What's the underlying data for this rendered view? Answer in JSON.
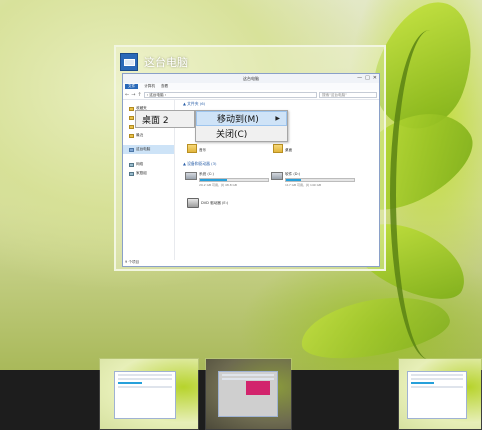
{
  "switcher": {
    "window_title": "这台电脑"
  },
  "explorer": {
    "titlebar_text": "这台电脑",
    "ribbon_tabs": [
      "文件",
      "计算机",
      "查看"
    ],
    "address": "› 这台电脑 ›",
    "search_placeholder": "搜索\"这台电脑\"",
    "nav_items": [
      {
        "label": "收藏夹",
        "icon": "star-icon"
      },
      {
        "label": "桌面",
        "icon": "folder-icon"
      },
      {
        "label": "下载",
        "icon": "folder-icon"
      },
      {
        "label": "最近",
        "icon": "folder-icon"
      },
      {
        "label": "这台电脑",
        "icon": "computer-icon"
      },
      {
        "label": "网络",
        "icon": "network-icon"
      },
      {
        "label": "家庭组",
        "icon": "homegroup-icon"
      }
    ],
    "folders_section": "▲ 文件夹 (6)",
    "folder_labels": [
      "音乐",
      "桌面"
    ],
    "devices_section": "▲ 设备和驱动器 (3)",
    "drives": [
      {
        "name": "系统 (C:)",
        "free": "29.2 GB 可用，共 48.8 GB",
        "used_fraction": 0.4
      },
      {
        "name": "软件 (D:)",
        "free": "117 GB 可用，共 149 GB",
        "used_fraction": 0.22
      }
    ],
    "dvd_label": "DVD 驱动器 (E:)",
    "status": "9 个项目",
    "window_buttons": [
      "—",
      "□",
      "✕"
    ]
  },
  "context_menu": {
    "parent_item": "桌面 2",
    "items": [
      {
        "label": "移动到(M)",
        "has_submenu": true
      },
      {
        "label": "关闭(C)",
        "has_submenu": false
      }
    ],
    "submenu_arrow": "▶"
  }
}
